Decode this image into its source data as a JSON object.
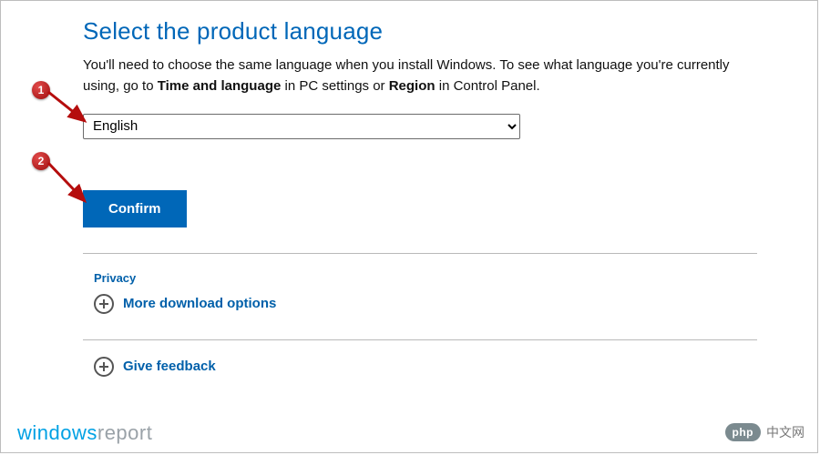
{
  "heading": "Select the product language",
  "description": {
    "pre": "You'll need to choose the same language when you install Windows. To see what language you're currently using, go to ",
    "bold1": "Time and language",
    "mid": " in PC settings or ",
    "bold2": "Region",
    "post": " in Control Panel."
  },
  "language_select": {
    "value": "English"
  },
  "confirm_label": "Confirm",
  "privacy_label": "Privacy",
  "more_downloads_label": "More download options",
  "feedback_label": "Give feedback",
  "callouts": {
    "one": "1",
    "two": "2"
  },
  "watermark_left": {
    "part1": "windows",
    "part2": "report"
  },
  "watermark_right": {
    "pill": "php",
    "text": "中文网"
  }
}
